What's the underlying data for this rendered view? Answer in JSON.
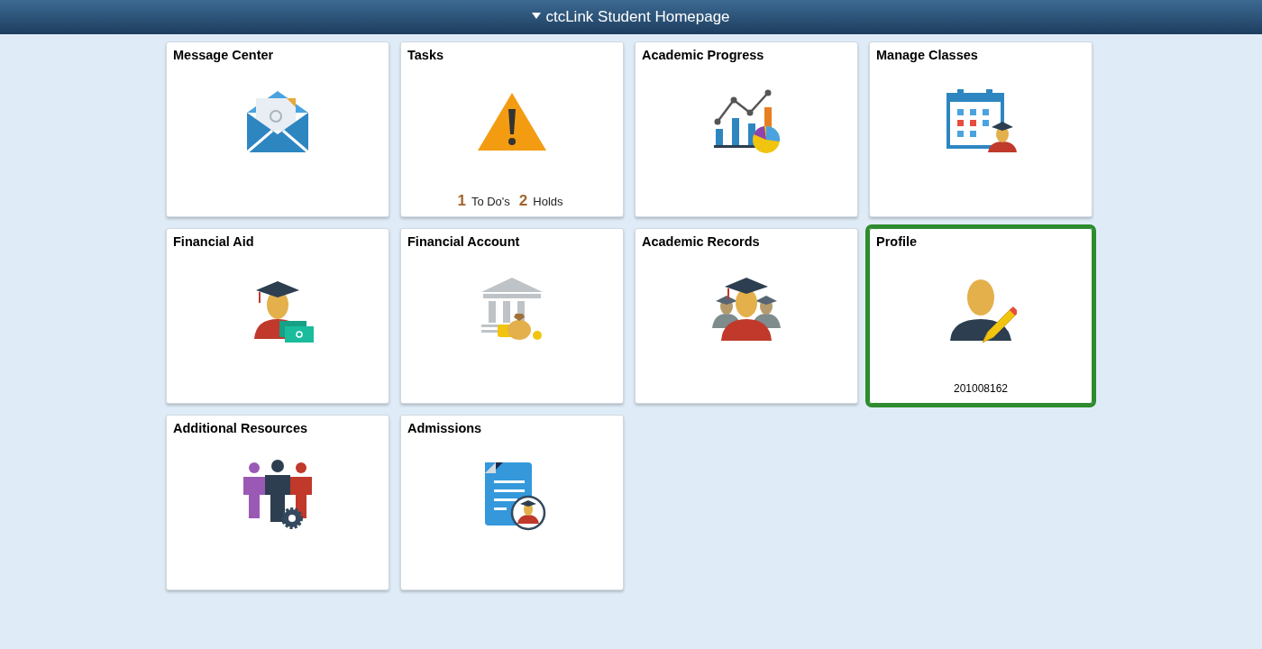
{
  "header": {
    "title": "ctcLink Student Homepage"
  },
  "tiles": [
    {
      "title": "Message Center",
      "kind": "envelope",
      "selected": false
    },
    {
      "title": "Tasks",
      "kind": "warning",
      "selected": false,
      "counts": [
        {
          "count": "1",
          "label": "To Do's"
        },
        {
          "count": "2",
          "label": "Holds"
        }
      ]
    },
    {
      "title": "Academic Progress",
      "kind": "chart",
      "selected": false
    },
    {
      "title": "Manage Classes",
      "kind": "calendar",
      "selected": false
    },
    {
      "title": "Financial Aid",
      "kind": "graduate-card",
      "selected": false
    },
    {
      "title": "Financial Account",
      "kind": "bank",
      "selected": false
    },
    {
      "title": "Academic Records",
      "kind": "graduates",
      "selected": false
    },
    {
      "title": "Profile",
      "kind": "person-pencil",
      "selected": true,
      "footer": "201008162"
    },
    {
      "title": "Additional Resources",
      "kind": "people-gear",
      "selected": false
    },
    {
      "title": "Admissions",
      "kind": "document",
      "selected": false
    }
  ]
}
